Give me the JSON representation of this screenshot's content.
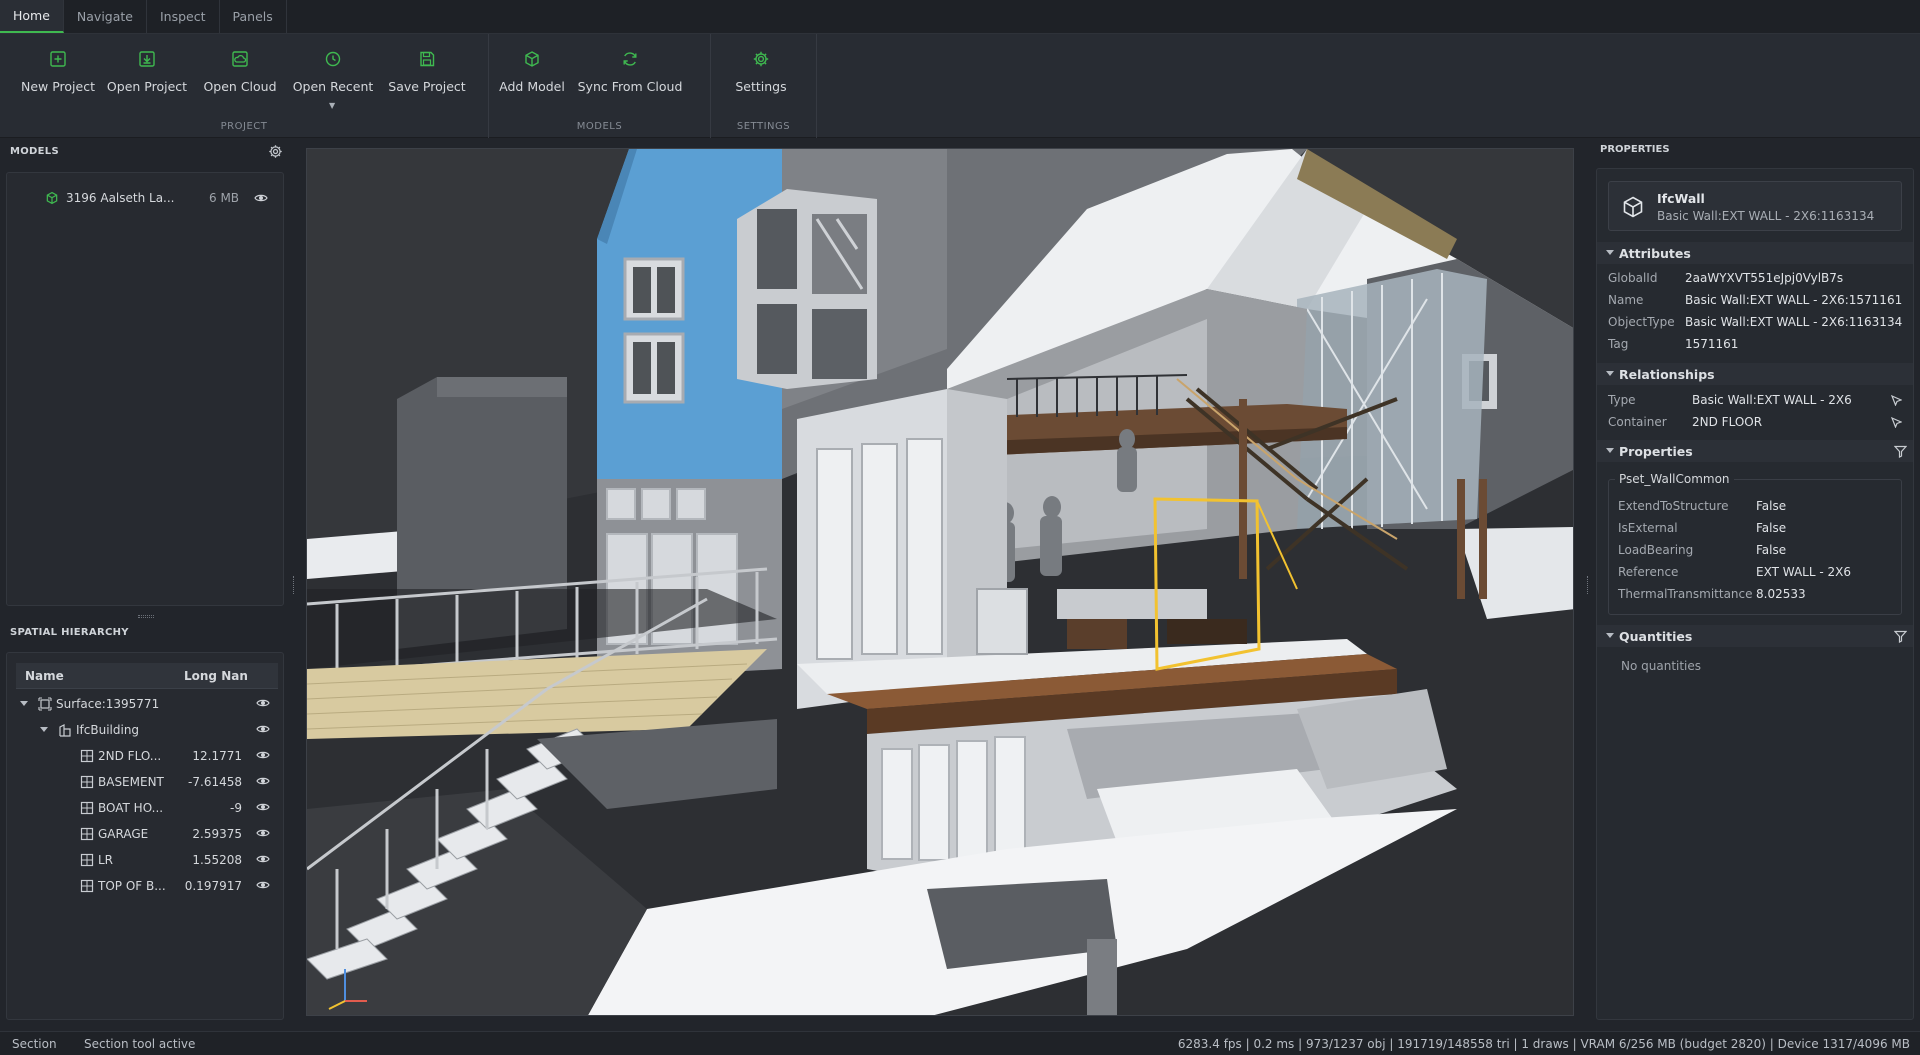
{
  "tabs": [
    "Home",
    "Navigate",
    "Inspect",
    "Panels"
  ],
  "ribbon": {
    "project_group": "PROJECT",
    "models_group": "MODELS",
    "settings_group": "SETTINGS",
    "new_project": "New Project",
    "open_project": "Open Project",
    "open_cloud": "Open Cloud",
    "open_recent": "Open Recent",
    "save_project": "Save Project",
    "add_model": "Add Model",
    "sync_from_cloud": "Sync From Cloud",
    "settings": "Settings"
  },
  "models": {
    "title": "MODELS",
    "items": [
      {
        "name": "3196 Aalseth La...",
        "size": "6 MB"
      }
    ]
  },
  "spatial": {
    "title": "SPATIAL HIERARCHY",
    "col_name": "Name",
    "col_long": "Long Nan",
    "rows": [
      {
        "name": "Surface:1395771",
        "value": ""
      },
      {
        "name": "IfcBuilding",
        "value": ""
      },
      {
        "name": "2ND FLO...",
        "value": "12.1771"
      },
      {
        "name": "BASEMENT",
        "value": "-7.61458"
      },
      {
        "name": "BOAT HO...",
        "value": "-9"
      },
      {
        "name": "GARAGE",
        "value": "2.59375"
      },
      {
        "name": "LR",
        "value": "1.55208"
      },
      {
        "name": "TOP OF B...",
        "value": "0.197917"
      }
    ]
  },
  "properties": {
    "title": "PROPERTIES",
    "entity_type": "IfcWall",
    "entity_name": "Basic Wall:EXT WALL - 2X6:1163134",
    "attributes_label": "Attributes",
    "attributes": [
      {
        "key": "GlobalId",
        "value": "2aaWYXVT551eJpj0VylB7s"
      },
      {
        "key": "Name",
        "value": "Basic Wall:EXT WALL - 2X6:1571161"
      },
      {
        "key": "ObjectType",
        "value": "Basic Wall:EXT WALL - 2X6:1163134"
      },
      {
        "key": "Tag",
        "value": "1571161"
      }
    ],
    "relationships_label": "Relationships",
    "relationships": [
      {
        "key": "Type",
        "value": "Basic Wall:EXT WALL - 2X6"
      },
      {
        "key": "Container",
        "value": "2ND FLOOR"
      }
    ],
    "properties_label": "Properties",
    "pset_name": "Pset_WallCommon",
    "pset": [
      {
        "key": "ExtendToStructure",
        "value": "False"
      },
      {
        "key": "IsExternal",
        "value": "False"
      },
      {
        "key": "LoadBearing",
        "value": "False"
      },
      {
        "key": "Reference",
        "value": "EXT WALL - 2X6"
      },
      {
        "key": "ThermalTransmittance",
        "value": "8.02533"
      }
    ],
    "quantities_label": "Quantities",
    "no_quantities": "No quantities"
  },
  "status": {
    "tool": "Section",
    "message": "Section tool active",
    "stats": "6283.4 fps | 0.2 ms | 973/1237 obj | 191719/148558 tri | 1 draws | VRAM 6/256 MB (budget 2820) | Device 1317/4096 MB"
  },
  "colors": {
    "accent": "#3fb950",
    "selection": "#f2c230",
    "facade_blue": "#5b9fd3"
  }
}
